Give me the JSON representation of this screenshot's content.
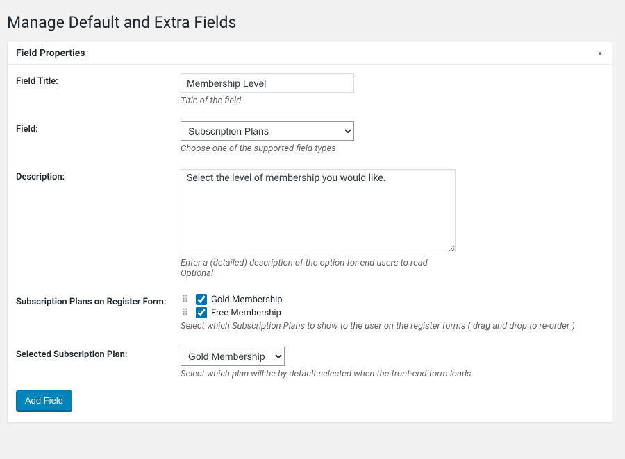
{
  "page": {
    "title": "Manage Default and Extra Fields"
  },
  "panel": {
    "title": "Field Properties"
  },
  "form": {
    "field_title": {
      "label": "Field Title:",
      "value": "Membership Level",
      "hint": "Title of the field"
    },
    "field_type": {
      "label": "Field:",
      "value": "Subscription Plans",
      "hint": "Choose one of the supported field types"
    },
    "description": {
      "label": "Description:",
      "value": "Select the level of membership you would like.",
      "hint1": "Enter a (detailed) description of the option for end users to read",
      "hint2": "Optional"
    },
    "plans_on_register": {
      "label": "Subscription Plans on Register Form:",
      "items": [
        {
          "label": "Gold Membership",
          "checked": true
        },
        {
          "label": "Free Membership",
          "checked": true
        }
      ],
      "hint": "Select which Subscription Plans to show to the user on the register forms ( drag and drop to re-order )"
    },
    "selected_plan": {
      "label": "Selected Subscription Plan:",
      "value": "Gold Membership",
      "hint": "Select which plan will be by default selected when the front-end form loads."
    }
  },
  "actions": {
    "add_field": "Add Field"
  }
}
